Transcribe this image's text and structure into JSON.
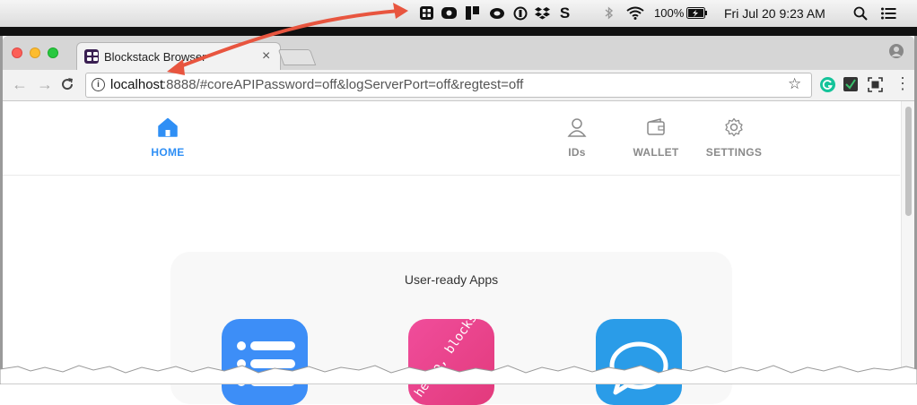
{
  "menubar": {
    "battery": "100%",
    "datetime": "Fri Jul 20  9:23 AM",
    "status_icons": [
      "blockstack-icon",
      "camera-icon",
      "trello-icon",
      "creative-cloud-icon",
      "onepassword-icon",
      "dropbox-icon",
      "s-icon",
      "bluetooth-icon",
      "wifi-icon",
      "battery-icon",
      "spotlight-icon",
      "notification-center-icon"
    ]
  },
  "tab": {
    "title": "Blockstack Browser"
  },
  "address": {
    "host": "localhost",
    "rest": ":8888/#coreAPIPassword=off&logServerPort=off&regtest=off"
  },
  "nav": {
    "home": "HOME",
    "ids": "IDs",
    "wallet": "WALLET",
    "settings": "SETTINGS"
  },
  "apps": {
    "title": "User-ready Apps",
    "hello_label": "hello, blockstack"
  },
  "colors": {
    "accent": "#2f8ff5",
    "arrow": "#e8553f",
    "app_blue": "#3d8ef7",
    "app_pink": "#ef3f8d",
    "app_cyan": "#2a9ce8"
  }
}
